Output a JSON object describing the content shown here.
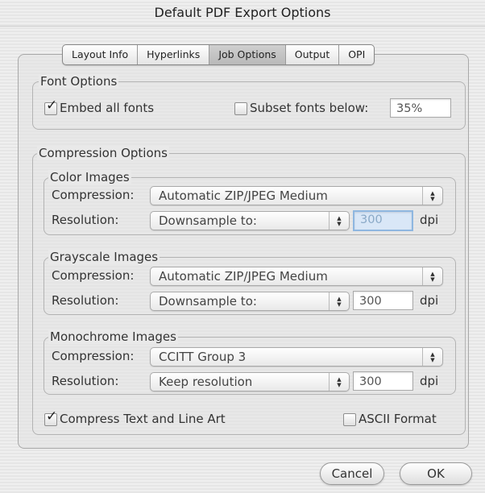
{
  "window": {
    "title": "Default PDF Export Options"
  },
  "tabs": [
    {
      "label": "Layout Info"
    },
    {
      "label": "Hyperlinks"
    },
    {
      "label": "Job Options"
    },
    {
      "label": "Output"
    },
    {
      "label": "OPI"
    }
  ],
  "font_options": {
    "legend": "Font Options",
    "embed_all_fonts": {
      "label": "Embed all fonts",
      "checked": true
    },
    "subset_fonts": {
      "label": "Subset fonts below:",
      "checked": false,
      "value": "35%"
    }
  },
  "compression_options": {
    "legend": "Compression Options",
    "color_images": {
      "legend": "Color Images",
      "compression_label": "Compression:",
      "compression_value": "Automatic ZIP/JPEG Medium",
      "resolution_label": "Resolution:",
      "resolution_value": "Downsample to:",
      "dpi_value": "300",
      "dpi_unit": "dpi"
    },
    "grayscale_images": {
      "legend": "Grayscale Images",
      "compression_label": "Compression:",
      "compression_value": "Automatic ZIP/JPEG Medium",
      "resolution_label": "Resolution:",
      "resolution_value": "Downsample to:",
      "dpi_value": "300",
      "dpi_unit": "dpi"
    },
    "monochrome_images": {
      "legend": "Monochrome Images",
      "compression_label": "Compression:",
      "compression_value": "CCITT Group 3",
      "resolution_label": "Resolution:",
      "resolution_value": "Keep resolution",
      "dpi_value": "300",
      "dpi_unit": "dpi"
    },
    "compress_text": {
      "label": "Compress Text and Line Art",
      "checked": true
    },
    "ascii_format": {
      "label": "ASCII Format",
      "checked": false
    }
  },
  "buttons": {
    "cancel": "Cancel",
    "ok": "OK"
  },
  "icons": {
    "check": "checkmark-icon",
    "stepper": "up-down-arrows-icon"
  },
  "colors": {
    "focus_field_border": "#8fb7e0",
    "focus_field_bg": "#d9e7f7"
  }
}
